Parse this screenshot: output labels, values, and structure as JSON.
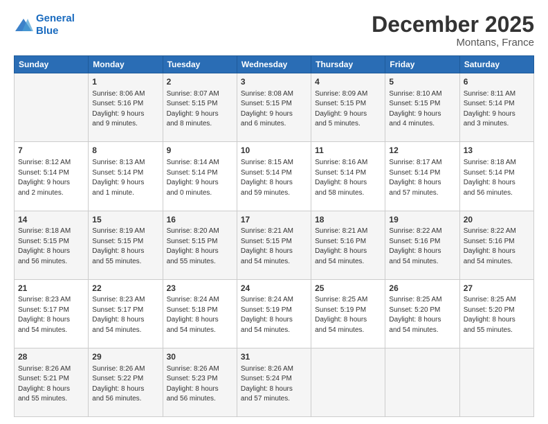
{
  "logo": {
    "line1": "General",
    "line2": "Blue"
  },
  "title": "December 2025",
  "location": "Montans, France",
  "weekdays": [
    "Sunday",
    "Monday",
    "Tuesday",
    "Wednesday",
    "Thursday",
    "Friday",
    "Saturday"
  ],
  "rows": [
    [
      {
        "day": "",
        "info": ""
      },
      {
        "day": "1",
        "info": "Sunrise: 8:06 AM\nSunset: 5:16 PM\nDaylight: 9 hours\nand 9 minutes."
      },
      {
        "day": "2",
        "info": "Sunrise: 8:07 AM\nSunset: 5:15 PM\nDaylight: 9 hours\nand 8 minutes."
      },
      {
        "day": "3",
        "info": "Sunrise: 8:08 AM\nSunset: 5:15 PM\nDaylight: 9 hours\nand 6 minutes."
      },
      {
        "day": "4",
        "info": "Sunrise: 8:09 AM\nSunset: 5:15 PM\nDaylight: 9 hours\nand 5 minutes."
      },
      {
        "day": "5",
        "info": "Sunrise: 8:10 AM\nSunset: 5:15 PM\nDaylight: 9 hours\nand 4 minutes."
      },
      {
        "day": "6",
        "info": "Sunrise: 8:11 AM\nSunset: 5:14 PM\nDaylight: 9 hours\nand 3 minutes."
      }
    ],
    [
      {
        "day": "7",
        "info": "Sunrise: 8:12 AM\nSunset: 5:14 PM\nDaylight: 9 hours\nand 2 minutes."
      },
      {
        "day": "8",
        "info": "Sunrise: 8:13 AM\nSunset: 5:14 PM\nDaylight: 9 hours\nand 1 minute."
      },
      {
        "day": "9",
        "info": "Sunrise: 8:14 AM\nSunset: 5:14 PM\nDaylight: 9 hours\nand 0 minutes."
      },
      {
        "day": "10",
        "info": "Sunrise: 8:15 AM\nSunset: 5:14 PM\nDaylight: 8 hours\nand 59 minutes."
      },
      {
        "day": "11",
        "info": "Sunrise: 8:16 AM\nSunset: 5:14 PM\nDaylight: 8 hours\nand 58 minutes."
      },
      {
        "day": "12",
        "info": "Sunrise: 8:17 AM\nSunset: 5:14 PM\nDaylight: 8 hours\nand 57 minutes."
      },
      {
        "day": "13",
        "info": "Sunrise: 8:18 AM\nSunset: 5:14 PM\nDaylight: 8 hours\nand 56 minutes."
      }
    ],
    [
      {
        "day": "14",
        "info": "Sunrise: 8:18 AM\nSunset: 5:15 PM\nDaylight: 8 hours\nand 56 minutes."
      },
      {
        "day": "15",
        "info": "Sunrise: 8:19 AM\nSunset: 5:15 PM\nDaylight: 8 hours\nand 55 minutes."
      },
      {
        "day": "16",
        "info": "Sunrise: 8:20 AM\nSunset: 5:15 PM\nDaylight: 8 hours\nand 55 minutes."
      },
      {
        "day": "17",
        "info": "Sunrise: 8:21 AM\nSunset: 5:15 PM\nDaylight: 8 hours\nand 54 minutes."
      },
      {
        "day": "18",
        "info": "Sunrise: 8:21 AM\nSunset: 5:16 PM\nDaylight: 8 hours\nand 54 minutes."
      },
      {
        "day": "19",
        "info": "Sunrise: 8:22 AM\nSunset: 5:16 PM\nDaylight: 8 hours\nand 54 minutes."
      },
      {
        "day": "20",
        "info": "Sunrise: 8:22 AM\nSunset: 5:16 PM\nDaylight: 8 hours\nand 54 minutes."
      }
    ],
    [
      {
        "day": "21",
        "info": "Sunrise: 8:23 AM\nSunset: 5:17 PM\nDaylight: 8 hours\nand 54 minutes."
      },
      {
        "day": "22",
        "info": "Sunrise: 8:23 AM\nSunset: 5:17 PM\nDaylight: 8 hours\nand 54 minutes."
      },
      {
        "day": "23",
        "info": "Sunrise: 8:24 AM\nSunset: 5:18 PM\nDaylight: 8 hours\nand 54 minutes."
      },
      {
        "day": "24",
        "info": "Sunrise: 8:24 AM\nSunset: 5:19 PM\nDaylight: 8 hours\nand 54 minutes."
      },
      {
        "day": "25",
        "info": "Sunrise: 8:25 AM\nSunset: 5:19 PM\nDaylight: 8 hours\nand 54 minutes."
      },
      {
        "day": "26",
        "info": "Sunrise: 8:25 AM\nSunset: 5:20 PM\nDaylight: 8 hours\nand 54 minutes."
      },
      {
        "day": "27",
        "info": "Sunrise: 8:25 AM\nSunset: 5:20 PM\nDaylight: 8 hours\nand 55 minutes."
      }
    ],
    [
      {
        "day": "28",
        "info": "Sunrise: 8:26 AM\nSunset: 5:21 PM\nDaylight: 8 hours\nand 55 minutes."
      },
      {
        "day": "29",
        "info": "Sunrise: 8:26 AM\nSunset: 5:22 PM\nDaylight: 8 hours\nand 56 minutes."
      },
      {
        "day": "30",
        "info": "Sunrise: 8:26 AM\nSunset: 5:23 PM\nDaylight: 8 hours\nand 56 minutes."
      },
      {
        "day": "31",
        "info": "Sunrise: 8:26 AM\nSunset: 5:24 PM\nDaylight: 8 hours\nand 57 minutes."
      },
      {
        "day": "",
        "info": ""
      },
      {
        "day": "",
        "info": ""
      },
      {
        "day": "",
        "info": ""
      }
    ]
  ]
}
